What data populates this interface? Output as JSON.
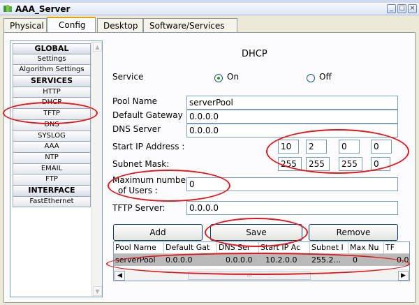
{
  "window": {
    "title": "AAA_Server",
    "buttons": [
      "_",
      "□",
      "×"
    ]
  },
  "tabs": [
    {
      "label": "Physical",
      "active": false
    },
    {
      "label": "Config",
      "active": true
    },
    {
      "label": "Desktop",
      "active": false
    },
    {
      "label": "Software/Services",
      "active": false
    }
  ],
  "sidebar": {
    "items": [
      {
        "label": "GLOBAL",
        "header": true
      },
      {
        "label": "Settings"
      },
      {
        "label": "Algorithm Settings"
      },
      {
        "label": "SERVICES",
        "header": true
      },
      {
        "label": "HTTP"
      },
      {
        "label": "DHCP"
      },
      {
        "label": "TFTP"
      },
      {
        "label": "DNS"
      },
      {
        "label": "SYSLOG"
      },
      {
        "label": "AAA"
      },
      {
        "label": "NTP"
      },
      {
        "label": "EMAIL"
      },
      {
        "label": "FTP"
      },
      {
        "label": "INTERFACE",
        "header": true
      },
      {
        "label": "FastEthernet"
      }
    ]
  },
  "dhcp": {
    "title": "DHCP",
    "service_label": "Service",
    "on_label": "On",
    "off_label": "Off",
    "service_on": true,
    "pool_name_label": "Pool Name",
    "pool_name": "serverPool",
    "default_gateway_label": "Default Gateway",
    "default_gateway": "0.0.0.0",
    "dns_server_label": "DNS Server",
    "dns_server": "0.0.0.0",
    "start_ip_label": "Start IP Address :",
    "start_ip": [
      "10",
      "2",
      "0",
      "0"
    ],
    "subnet_mask_label": "Subnet Mask:",
    "subnet_mask": [
      "255",
      "255",
      "255",
      "0"
    ],
    "max_users_label_1": "Maximum number",
    "max_users_label_2": "of Users :",
    "max_users": "0",
    "tftp_label": "TFTP Server:",
    "tftp_server": "0.0.0.0",
    "add_label": "Add",
    "save_label": "Save",
    "remove_label": "Remove"
  },
  "pool_table": {
    "columns": [
      "Pool Name",
      "Default Gat",
      "DNS Ser",
      "Start IP Ac",
      "Subnet I",
      "Max Nu",
      "TF"
    ],
    "rows": [
      [
        "serverPool",
        "0.0.0.0",
        "0.0.0.0",
        "10.2.0.0",
        "255.2...",
        "0",
        "0.0"
      ]
    ],
    "scroll_thumb": "III"
  },
  "colors": {
    "annotation": "#e2161b",
    "active_tab_accent": "#e6a200",
    "radio_dot": "#21a121"
  }
}
